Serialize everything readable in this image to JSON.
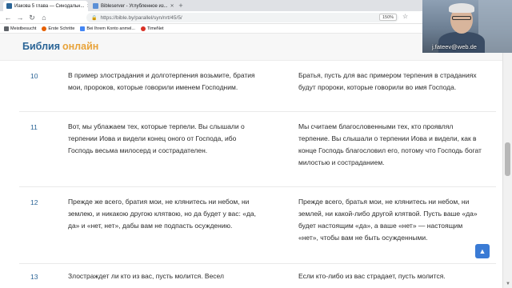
{
  "browser": {
    "tabs": [
      {
        "title": "Иакова 5 глава — Синодальн...",
        "favicon_color": "#2a6496",
        "active": true
      },
      {
        "title": "Bibleserver - Углубленное из...",
        "favicon_color": "#5a8fd6",
        "active": false
      }
    ],
    "url": "https://bible.by/parallel/syn/nrt/45/5/",
    "zoom": "150%",
    "bookmarks": [
      {
        "label": "Meistbesucht",
        "icon_color": "#5f6368"
      },
      {
        "label": "Erste Schritte",
        "icon_color": "#e66000"
      },
      {
        "label": "Bei Ihrem Konto anmel...",
        "icon_color": "#4285f4"
      },
      {
        "label": "TimeNet",
        "icon_color": "#d93025"
      }
    ]
  },
  "site": {
    "logo_main": "Библия",
    "logo_accent": "онлайн"
  },
  "webcam": {
    "participant_name": "j.fateev@web.de"
  },
  "verses": [
    {
      "number": "10",
      "left": "В пример злострадания и долготерпения возьмите, братия мои, пророков, которые говорили именем Господним.",
      "right": "Братья, пусть для вас примером терпения в страданиях будут пророки, которые говорили во имя Господа."
    },
    {
      "number": "11",
      "left": "Вот, мы ублажаем тех, которые терпели. Вы слышали о терпении Иова и видели конец оного от Господа, ибо Господь весьма милосерд и сострадателен.",
      "right": "Мы считаем благословенными тех, кто проявлял терпение. Вы слышали о терпении Иова и видели, как в конце Господь благословил его, потому что Господь богат милостью и состраданием."
    },
    {
      "number": "12",
      "left": "Прежде же всего, братия мои, не клянитесь ни небом, ни землею, и никакою другою клятвою, но да будет у вас: «да, да» и «нет, нет», дабы вам не подпасть осуждению.",
      "right": "Прежде всего, братья мои, не клянитесь ни небом, ни землей, ни какой-либо другой клятвой. Пусть ваше «да» будет настоящим «да», а ваше «нет» — настоящим «нет», чтобы вам не быть осужденными."
    },
    {
      "number": "13",
      "left": "Злостраждет ли кто из вас, пусть молится. Весел",
      "right": "Если кто-либо из вас страдает, пусть молится."
    }
  ],
  "colors": {
    "accent_blue": "#2a6496",
    "logo_accent": "#e8a33a",
    "to_top_button": "#3a7bd5"
  }
}
